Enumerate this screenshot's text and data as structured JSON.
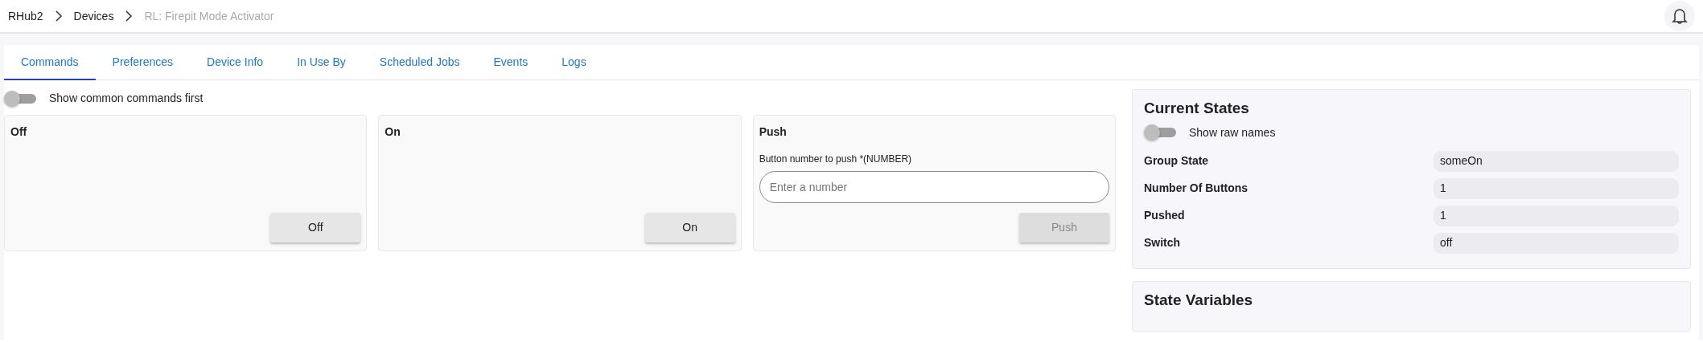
{
  "breadcrumb": [
    {
      "label": "RHub2",
      "current": false
    },
    {
      "label": "Devices",
      "current": false
    },
    {
      "label": "RL: Firepit Mode Activator",
      "current": true
    }
  ],
  "tabs": [
    {
      "label": "Commands",
      "selected": true
    },
    {
      "label": "Preferences",
      "selected": false
    },
    {
      "label": "Device Info",
      "selected": false
    },
    {
      "label": "In Use By",
      "selected": false
    },
    {
      "label": "Scheduled Jobs",
      "selected": false
    },
    {
      "label": "Events",
      "selected": false
    },
    {
      "label": "Logs",
      "selected": false
    }
  ],
  "common_toggle": {
    "label": "Show common commands first",
    "on": false
  },
  "commands": [
    {
      "title": "Off",
      "button": "Off",
      "disabled": false
    },
    {
      "title": "On",
      "button": "On",
      "disabled": false
    },
    {
      "title": "Push",
      "param_label": "Button number to push *(NUMBER)",
      "placeholder": "Enter a number",
      "button": "Push",
      "disabled": true
    }
  ],
  "current_states": {
    "title": "Current States",
    "toggle": {
      "label": "Show raw names",
      "on": false
    },
    "rows": [
      {
        "name": "Group State",
        "value": "someOn"
      },
      {
        "name": "Number Of Buttons",
        "value": "1"
      },
      {
        "name": "Pushed",
        "value": "1"
      },
      {
        "name": "Switch",
        "value": "off"
      }
    ]
  },
  "state_variables": {
    "title": "State Variables"
  }
}
